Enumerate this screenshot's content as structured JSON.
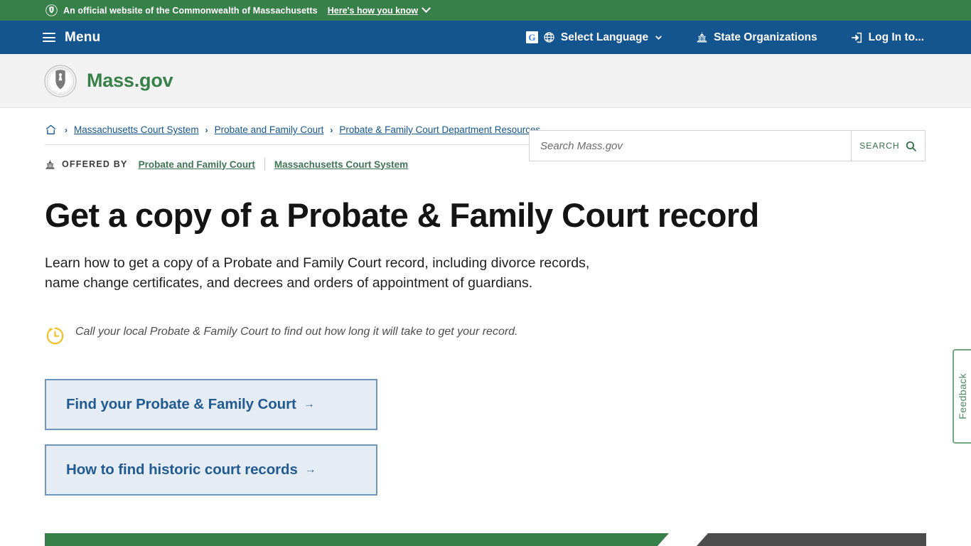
{
  "gov_banner": {
    "seal_icon": "state-seal-icon",
    "text": "An official website of the Commonwealth of Massachusetts",
    "how_you_know_label": "Here's how you know",
    "chevron_icon": "chevron-down-icon",
    "background_color": "#388049"
  },
  "main_nav": {
    "background_color": "#14558f",
    "menu_icon": "hamburger-menu-icon",
    "menu_label": "Menu",
    "items": [
      {
        "icon": "google-translate-icon",
        "secondary_icon": "globe-icon",
        "label": "Select Language",
        "chevron": "chevron-down-icon"
      },
      {
        "icon": "capitol-building-icon",
        "label": "State Organizations"
      },
      {
        "icon": "login-arrow-icon",
        "label": "Log In to..."
      }
    ]
  },
  "header": {
    "logo_icon": "mass-state-seal-icon",
    "brand": "Mass.gov",
    "brand_color": "#388049",
    "background_color": "#f2f2f2"
  },
  "search": {
    "placeholder": "Search Mass.gov",
    "value": "",
    "button_label": "SEARCH",
    "button_icon": "magnifier-icon",
    "accent_color": "#32704a"
  },
  "breadcrumb": {
    "home_icon": "home-icon",
    "separator": "›",
    "items": [
      {
        "label": "Massachusetts Court System"
      },
      {
        "label": "Probate and Family Court"
      },
      {
        "label": "Probate & Family Court Department Resources"
      }
    ],
    "link_color": "#14558f"
  },
  "offered_by": {
    "icon": "capitol-building-icon",
    "label": "OFFERED BY",
    "agencies": [
      {
        "label": "Probate and Family Court"
      },
      {
        "label": "Massachusetts Court System"
      }
    ],
    "link_color": "#3f7553"
  },
  "main": {
    "title": "Get a copy of a Probate & Family Court record",
    "description": "Learn how to get a copy of a Probate and Family Court record, including divorce records, name change certificates, and decrees and orders of appointment of guardians.",
    "notice": {
      "icon": "clock-arrow-icon",
      "icon_color": "#f2c023",
      "text": "Call your local Probate & Family Court to find out how long it will take to get your record."
    },
    "actions": [
      {
        "label": "Find your Probate & Family Court",
        "arrow": "→",
        "icon": "arrow-right-icon"
      },
      {
        "label": "How to find historic court records",
        "arrow": "→",
        "icon": "arrow-right-icon"
      }
    ],
    "action_color": "#215b92",
    "action_background": "#e6ecf4",
    "action_border": "#6e96bd"
  },
  "feedback": {
    "label": "Feedback",
    "color": "#4f8b62"
  },
  "footer_bars": {
    "green": "#388049",
    "dark": "#4d4d4d"
  }
}
